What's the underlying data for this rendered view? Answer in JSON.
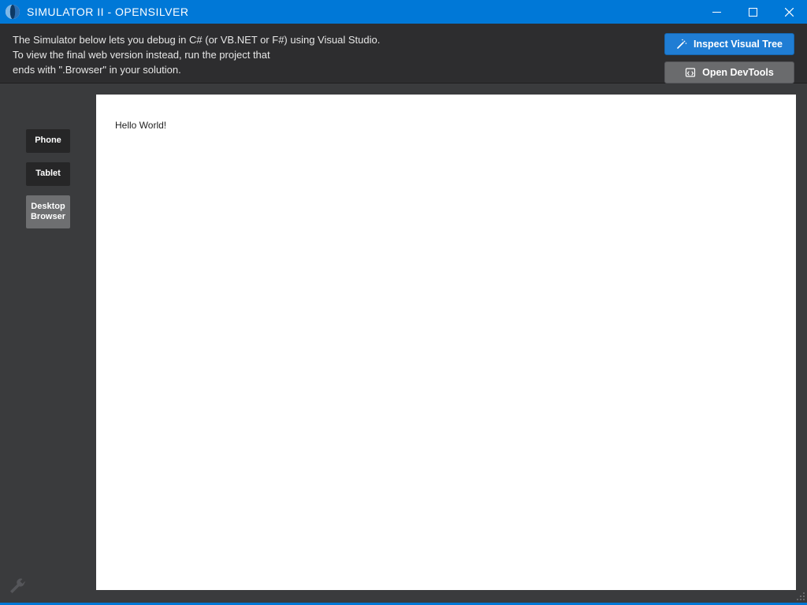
{
  "window": {
    "title": "SIMULATOR II - OPENSILVER"
  },
  "infobar": {
    "message_line1": "The Simulator below lets you debug in C# (or VB.NET or F#) using Visual Studio.",
    "message_line2": "To view the final web version instead, run the project that",
    "message_line3": "ends with \".Browser\" in your solution.",
    "inspect_label": "Inspect Visual Tree",
    "devtools_label": "Open DevTools"
  },
  "sidebar": {
    "phone_label": "Phone",
    "tablet_label": "Tablet",
    "desktop_label": "Desktop Browser"
  },
  "canvas": {
    "greeting": "Hello World!"
  },
  "colors": {
    "accent": "#0078d7",
    "panel_dark": "#2d2d2f",
    "body_dark": "#3a3b3d",
    "btn_primary": "#1f7dd4",
    "btn_secondary": "#6a6b6d"
  }
}
